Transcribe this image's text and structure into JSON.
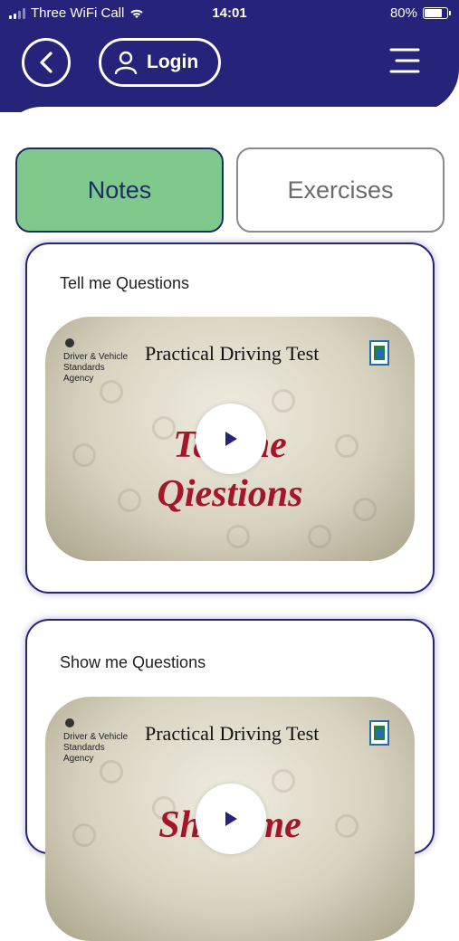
{
  "status_bar": {
    "carrier": "Three WiFi Call",
    "time": "14:01",
    "battery": "80%",
    "battery_level": 0.8
  },
  "nav": {
    "back_icon": "chevron-left-icon",
    "login_label": "Login",
    "user_icon": "user-icon",
    "menu_icon": "hamburger-menu-icon"
  },
  "tabs": [
    {
      "label": "Notes",
      "active": true
    },
    {
      "label": "Exercises",
      "active": false
    }
  ],
  "cards": [
    {
      "title": "Tell me Questions",
      "video": {
        "agency": [
          "Driver & Vehicle",
          "Standards",
          "Agency"
        ],
        "heading": "Practical Driving Test",
        "big_text_line1": "Tell me",
        "big_text_line2": "Qiestions",
        "play_icon": "play-icon"
      }
    },
    {
      "title": "Show me Questions",
      "video": {
        "agency": [
          "Driver & Vehicle",
          "Standards",
          "Agency"
        ],
        "heading": "Practical Driving Test",
        "big_text_line1": "Show me",
        "play_icon": "play-icon"
      }
    }
  ],
  "colors": {
    "header": "#25237a",
    "active_tab": "#7fc98c",
    "title_red": "#a4162a"
  }
}
